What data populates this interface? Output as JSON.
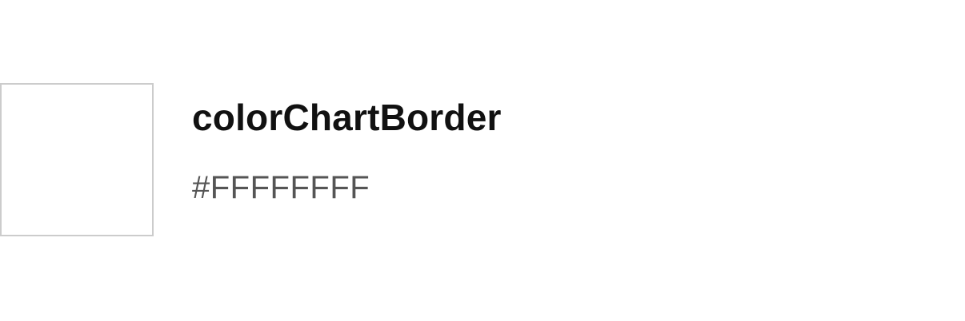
{
  "token": {
    "name": "colorChartBorder",
    "value": "#FFFFFFFF",
    "swatch_color": "#FFFFFF",
    "swatch_border_color": "#CCCCCC"
  }
}
